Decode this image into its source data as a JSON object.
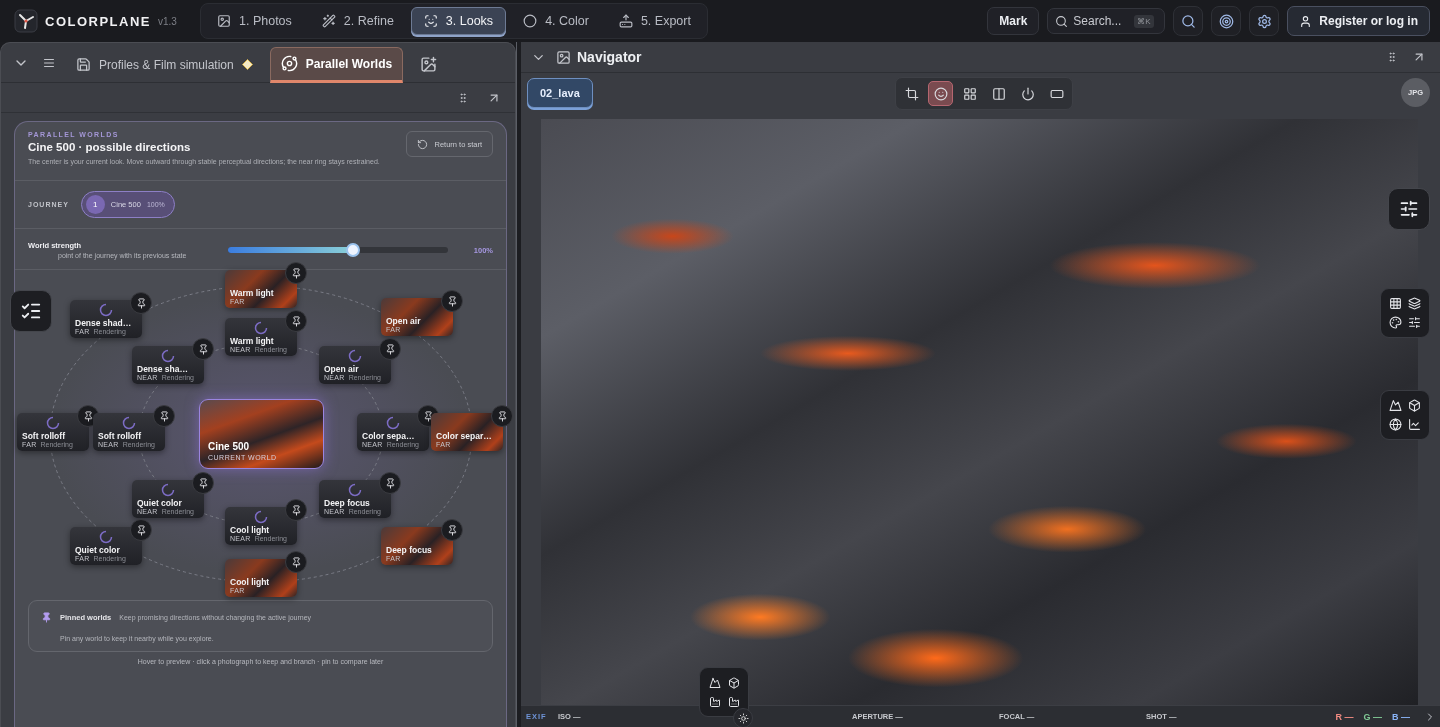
{
  "app": {
    "name": "COLORPLANE",
    "version": "v1.3"
  },
  "steps": [
    {
      "label": "1. Photos",
      "selected": false
    },
    {
      "label": "2. Refine",
      "selected": false
    },
    {
      "label": "3. Looks",
      "selected": true
    },
    {
      "label": "4. Color",
      "selected": false
    },
    {
      "label": "5. Export",
      "selected": false
    }
  ],
  "user_button": "Mark",
  "search": {
    "placeholder": "Search...",
    "shortcut": "⌘K"
  },
  "login_button": "Register or log in",
  "left_panel": {
    "tabs": [
      {
        "kind": "text",
        "label": "Profiles & Film simulation",
        "selected": false
      },
      {
        "kind": "text",
        "label": "Parallel Worlds",
        "selected": true
      },
      {
        "kind": "icon",
        "selected": false
      }
    ],
    "worlds": {
      "eyebrow": "PARALLEL WORLDS",
      "title": "Cine 500 · possible directions",
      "description": "The center is your current look. Move outward through stable perceptual directions; the near ring stays restrained.",
      "return_button": "Return to start",
      "journey_label": "JOURNEY",
      "journey": [
        {
          "index": "1",
          "name": "Cine 500",
          "strength": "100%",
          "selected": true
        }
      ],
      "strength": {
        "label": "World strength",
        "hint": "point of the journey with its previous state",
        "level": 0.57,
        "reading": "100%"
      },
      "center": {
        "name": "Cine 500",
        "caption": "CURRENT WORLD"
      },
      "nodes": [
        {
          "label": "Warm light",
          "tier": "FAR",
          "kind": "photo"
        },
        {
          "label": "Dense shad…",
          "tier": "FAR",
          "kind": "loading",
          "status": "Rendering"
        },
        {
          "label": "Warm light",
          "tier": "NEAR",
          "kind": "loading",
          "status": "Rendering"
        },
        {
          "label": "Open air",
          "tier": "FAR",
          "kind": "photo"
        },
        {
          "label": "Dense sha…",
          "tier": "NEAR",
          "kind": "loading",
          "status": "Rendering"
        },
        {
          "label": "Open air",
          "tier": "NEAR",
          "kind": "loading",
          "status": "Rendering"
        },
        {
          "label": "Soft rolloff",
          "tier": "FAR",
          "kind": "loading",
          "status": "Rendering"
        },
        {
          "label": "Soft rolloff",
          "tier": "NEAR",
          "kind": "loading",
          "status": "Rendering"
        },
        {
          "label": "Color sepa…",
          "tier": "NEAR",
          "kind": "loading",
          "status": "Rendering"
        },
        {
          "label": "Color separ…",
          "tier": "FAR",
          "kind": "photo"
        },
        {
          "label": "Quiet color",
          "tier": "NEAR",
          "kind": "loading",
          "status": "Rendering"
        },
        {
          "label": "Deep focus",
          "tier": "NEAR",
          "kind": "loading",
          "status": "Rendering"
        },
        {
          "label": "Quiet color",
          "tier": "FAR",
          "kind": "loading",
          "status": "Rendering"
        },
        {
          "label": "Cool light",
          "tier": "NEAR",
          "kind": "loading",
          "status": "Rendering"
        },
        {
          "label": "Deep focus",
          "tier": "FAR",
          "kind": "photo"
        },
        {
          "label": "Cool light",
          "tier": "FAR",
          "kind": "photo"
        }
      ],
      "pinned": {
        "title": "Pinned worlds",
        "subtitle": "Keep promising directions without changing the active journey",
        "empty": "Pin any world to keep it nearby while you explore."
      },
      "footer": "Hover to preview · click a photograph to keep and branch · pin to compare later"
    }
  },
  "navigator": {
    "title": "Navigator",
    "file_tab": "02_lava",
    "tools": [
      {
        "selected": false
      },
      {
        "selected": true
      },
      {
        "selected": false
      },
      {
        "selected": false
      },
      {
        "selected": false
      },
      {
        "selected": false
      }
    ],
    "format_badge": "JPG"
  },
  "exif": {
    "label": "EXIF",
    "fields": [
      {
        "label": "ISO",
        "value": "—"
      },
      {
        "label": "APERTURE",
        "value": "—"
      },
      {
        "label": "FOCAL",
        "value": "—"
      },
      {
        "label": "SHOT",
        "value": "—"
      }
    ],
    "channels": [
      {
        "label": "R",
        "value": "—",
        "color": "#f28b82"
      },
      {
        "label": "G",
        "value": "—",
        "color": "#81c995"
      },
      {
        "label": "B",
        "value": "—",
        "color": "#8ab4f8"
      }
    ]
  }
}
